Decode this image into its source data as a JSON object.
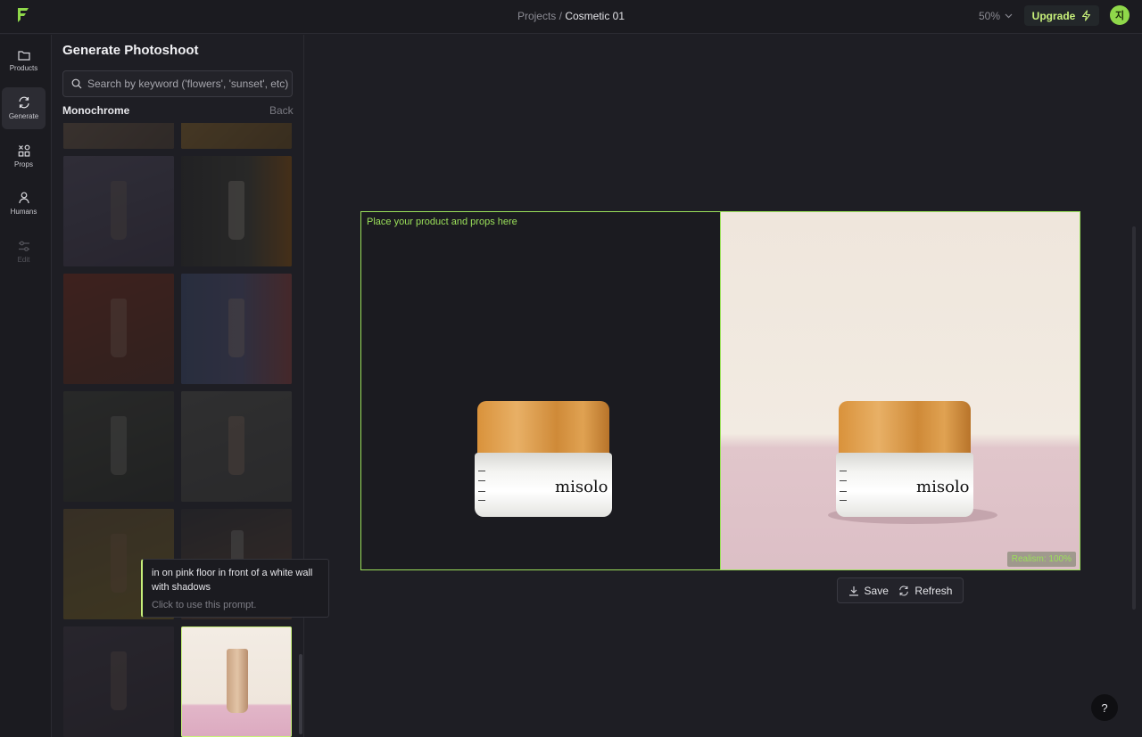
{
  "topbar": {
    "breadcrumb_parent": "Projects",
    "breadcrumb_sep": " / ",
    "breadcrumb_current": "Cosmetic 01",
    "zoom_label": "50%",
    "upgrade_label": "Upgrade",
    "avatar_initial": "지",
    "accent_color": "#c7f07a"
  },
  "rail": {
    "items": [
      {
        "label": "Products",
        "icon": "folder-icon"
      },
      {
        "label": "Generate",
        "icon": "refresh-icon"
      },
      {
        "label": "Props",
        "icon": "shapes-icon"
      },
      {
        "label": "Humans",
        "icon": "person-icon"
      },
      {
        "label": "Edit",
        "icon": "sliders-icon"
      }
    ]
  },
  "panel": {
    "title": "Generate Photoshoot",
    "search_placeholder": "Search by keyword ('flowers', 'sunset', etc)",
    "section_title": "Monochrome",
    "back_label": "Back"
  },
  "tooltip": {
    "prompt": "in on pink floor in front of a white wall with shadows",
    "hint": "Click to use this prompt."
  },
  "canvas": {
    "placeholder_hint": "Place your product and props here",
    "realism_label": "Realism: 100%",
    "brand_text": "misolo",
    "save_label": "Save",
    "refresh_label": "Refresh",
    "help_label": "?"
  }
}
